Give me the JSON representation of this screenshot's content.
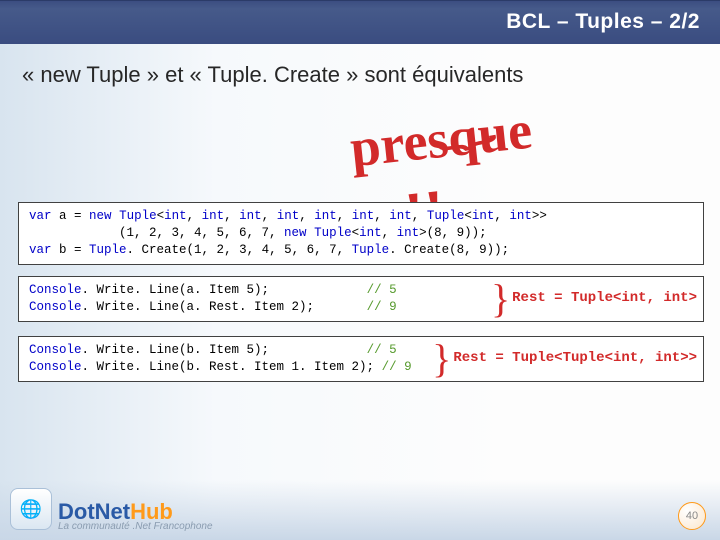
{
  "header": {
    "title": "BCL – Tuples – 2/2"
  },
  "subtitle": "« new Tuple » et « Tuple. Create » sont équivalents",
  "callout": {
    "word": "presque",
    "bangs": "!!",
    "brace": "⏟"
  },
  "code": {
    "line1a": "var",
    "line1b": " a = ",
    "line1c": "new",
    "line1d": " ",
    "line1e": "Tuple",
    "line1f": "<",
    "line1g": "int",
    "line1h": ", ",
    "line1i": "int",
    "line1j": ", ",
    "line1k": "int",
    "line1l": ", ",
    "line1m": "int",
    "line1n": ", ",
    "line1o": "int",
    "line1p": ", ",
    "line1q": "int",
    "line1r": ", ",
    "line1s": "int",
    "line1t": ", ",
    "line1u": "Tuple",
    "line1v": "<",
    "line1w": "int",
    "line1x": ", ",
    "line1y": "int",
    "line1z": ">>",
    "line2a": "            (1, 2, 3, 4, 5, 6, 7, ",
    "line2b": "new",
    "line2c": " ",
    "line2d": "Tuple",
    "line2e": "<",
    "line2f": "int",
    "line2g": ", ",
    "line2h": "int",
    "line2i": ">(8, 9));",
    "line3a": "var",
    "line3b": " b = ",
    "line3c": "Tuple",
    "line3d": ". Create(1, 2, 3, 4, 5, 6, 7, ",
    "line3e": "Tuple",
    "line3f": ". Create(8, 9));",
    "b2l1a": "Console",
    "b2l1b": ". Write. Line(a. Item 5);",
    "b2l2a": "Console",
    "b2l2b": ". Write. Line(a. Rest. Item 2);",
    "b2c1": "// 5",
    "b2c2": "// 9",
    "b3l1a": "Console",
    "b3l1b": ". Write. Line(b. Item 5);",
    "b3l2a": "Console",
    "b3l2b": ". Write. Line(b. Rest. Item 1. Item 2);",
    "b3c1": "// 5",
    "b3c2": "// 9"
  },
  "notes": {
    "n1": "Rest = Tuple<int, int>",
    "n2": "Rest = Tuple<Tuple<int, int>>"
  },
  "footer": {
    "brand1": "DotNet",
    "brand2": "Hub",
    "tagline": "La communauté .Net Francophone",
    "badge": "🌐",
    "page": "40"
  }
}
